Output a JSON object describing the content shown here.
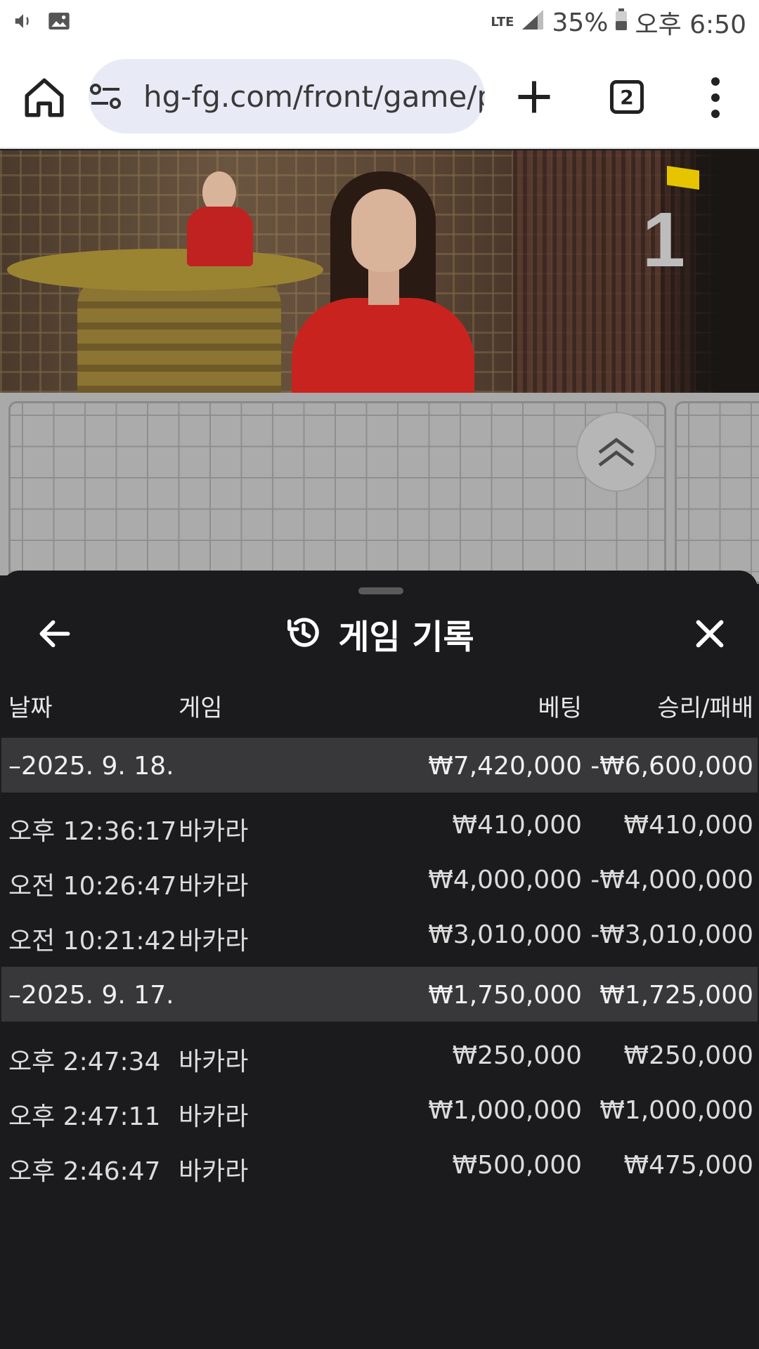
{
  "status_bar": {
    "network": "LTE",
    "battery": "35%",
    "time": "오후 6:50"
  },
  "browser": {
    "url": "hg-fg.com/front/game/p",
    "tab_count": "2"
  },
  "video": {
    "round_number": "1"
  },
  "sheet": {
    "title": "게임 기록",
    "columns": {
      "date": "날짜",
      "game": "게임",
      "bet": "베팅",
      "win_loss": "승리/패배"
    },
    "groups": [
      {
        "date": "–2025. 9. 18.",
        "bet_total": "₩7,420,000",
        "wl_total": "-₩6,600,000",
        "rows": [
          {
            "time": "오후 12:36:17",
            "game": "바카라",
            "bet": "₩410,000",
            "wl": "₩410,000"
          },
          {
            "time": "오전 10:26:47",
            "game": "바카라",
            "bet": "₩4,000,000",
            "wl": "-₩4,000,000"
          },
          {
            "time": "오전 10:21:42",
            "game": "바카라",
            "bet": "₩3,010,000",
            "wl": "-₩3,010,000"
          }
        ]
      },
      {
        "date": "–2025. 9. 17.",
        "bet_total": "₩1,750,000",
        "wl_total": "₩1,725,000",
        "rows": [
          {
            "time": "오후 2:47:34",
            "game": "바카라",
            "bet": "₩250,000",
            "wl": "₩250,000"
          },
          {
            "time": "오후 2:47:11",
            "game": "바카라",
            "bet": "₩1,000,000",
            "wl": "₩1,000,000"
          },
          {
            "time": "오후 2:46:47",
            "game": "바카라",
            "bet": "₩500,000",
            "wl": "₩475,000"
          }
        ]
      }
    ]
  }
}
